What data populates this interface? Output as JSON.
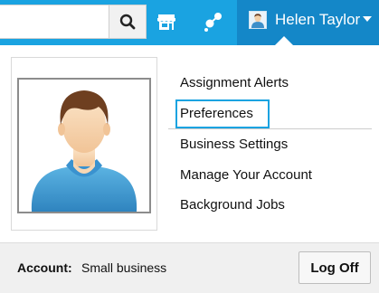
{
  "header": {
    "search": {
      "value": "",
      "placeholder": ""
    },
    "search_icon": "search-icon",
    "store_icon": "store-icon",
    "share_icon": "share-icon",
    "user": {
      "name": "Helen Taylor",
      "avatar_icon": "user-avatar-icon",
      "caret_icon": "caret-down-icon"
    }
  },
  "dropdown": {
    "profile_image": "user-silhouette",
    "menu": [
      {
        "label": "Assignment Alerts"
      },
      {
        "label": "Preferences"
      },
      {
        "label": "Business Settings"
      },
      {
        "label": "Manage Your Account"
      },
      {
        "label": "Background Jobs"
      }
    ],
    "account_label": "Account:",
    "account_value": "Small business",
    "logoff_label": "Log Off"
  },
  "colors": {
    "topbar": "#1aa3e1",
    "user_menu": "#1487c8",
    "focus_border": "#1aa3e1",
    "footer_bg": "#f0f0f0"
  }
}
